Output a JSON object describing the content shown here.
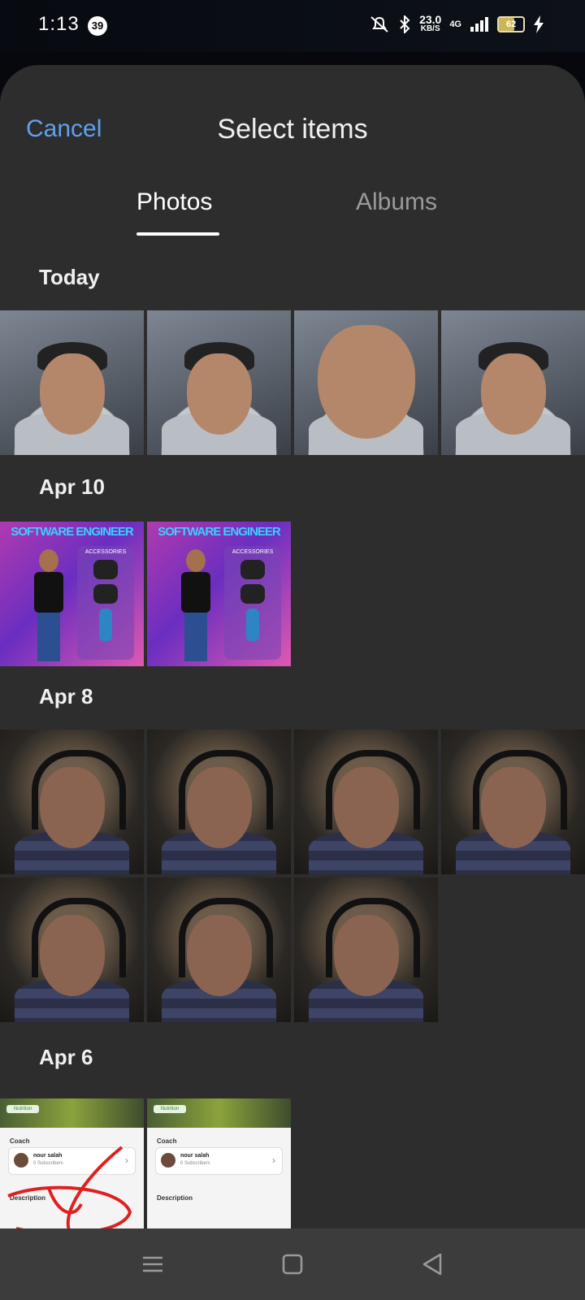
{
  "status_bar": {
    "time": "1:13",
    "notification_count": "39",
    "net_speed_value": "23.0",
    "net_speed_unit": "KB/S",
    "network": "4G",
    "battery": "62"
  },
  "header": {
    "cancel_label": "Cancel",
    "title": "Select items"
  },
  "tabs": {
    "photos": "Photos",
    "albums": "Albums",
    "active": "Photos"
  },
  "sections": [
    {
      "label": "Today",
      "count": 4
    },
    {
      "label": "Apr 10",
      "count": 2
    },
    {
      "label": "Apr 8",
      "count": 7
    },
    {
      "label": "Apr 6",
      "count": 2
    }
  ],
  "poster_text": {
    "banner": "SOFTWARE ENGINEER",
    "accessories": "ACCESSORIES"
  },
  "screenshot_text": {
    "chip": "Nutrition",
    "coach": "Coach",
    "name": "nour salah",
    "sub": "0 Subscribers",
    "description": "Description"
  },
  "nav_bar": {
    "icons": [
      "menu-icon",
      "home-icon",
      "back-icon"
    ]
  },
  "colors": {
    "accent": "#5ea2f0",
    "sheet_bg": "#2d2d2d",
    "nav_bg": "#3c3c3c"
  }
}
